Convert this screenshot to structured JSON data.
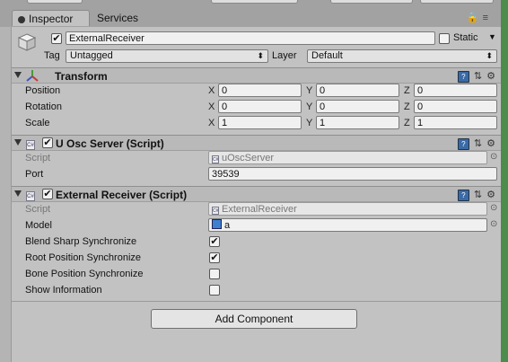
{
  "tabs": [
    {
      "label": "Inspector",
      "active": true
    },
    {
      "label": "Services",
      "active": false
    }
  ],
  "gameobject": {
    "name": "ExternalReceiver",
    "static_label": "Static",
    "static_checked": false,
    "active_checked": true,
    "tag_label": "Tag",
    "tag_value": "Untagged",
    "layer_label": "Layer",
    "layer_value": "Default"
  },
  "transform": {
    "title": "Transform",
    "rows": [
      {
        "label": "Position",
        "x": "0",
        "y": "0",
        "z": "0"
      },
      {
        "label": "Rotation",
        "x": "0",
        "y": "0",
        "z": "0"
      },
      {
        "label": "Scale",
        "x": "1",
        "y": "1",
        "z": "1"
      }
    ],
    "axis_labels": [
      "X",
      "Y",
      "Z"
    ]
  },
  "uosc": {
    "title": "U Osc Server (Script)",
    "enabled": true,
    "script_label": "Script",
    "script_value": "uOscServer",
    "port_label": "Port",
    "port_value": "39539"
  },
  "receiver": {
    "title": "External Receiver (Script)",
    "enabled": true,
    "script_label": "Script",
    "script_value": "ExternalReceiver",
    "model_label": "Model",
    "model_value": "a",
    "options": [
      {
        "label": "Blend Sharp Synchronize",
        "checked": true
      },
      {
        "label": "Root Position Synchronize",
        "checked": true
      },
      {
        "label": "Bone Position Synchronize",
        "checked": false
      },
      {
        "label": "Show Information",
        "checked": false
      }
    ]
  },
  "add_component_label": "Add Component",
  "colors": {
    "accent_green": "#4c8c4c",
    "panel_bg": "#c2c2c2"
  }
}
